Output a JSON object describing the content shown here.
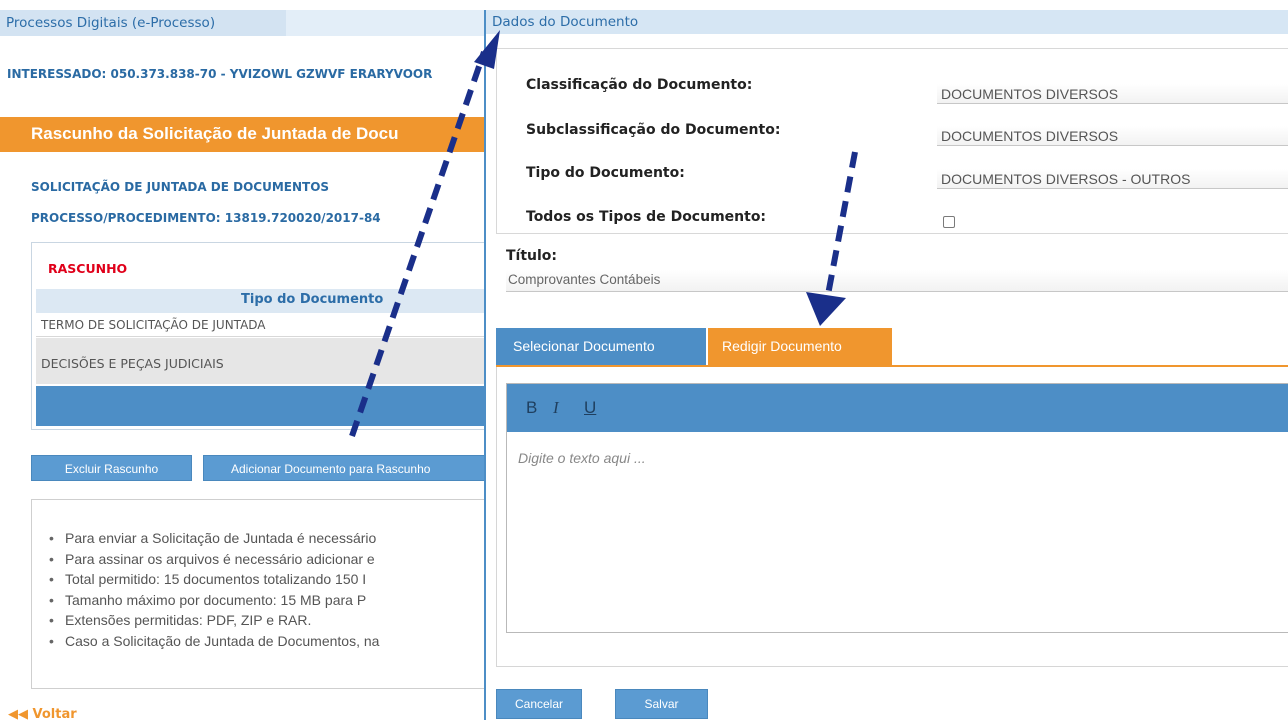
{
  "background": {
    "title": "Processos Digitais (e-Processo)",
    "interessado": "INTERESSADO: 050.373.838-70 - YVIZOWL GZWVF ERARYVOOR",
    "band_title": "Rascunho da Solicitação de Juntada de Docu",
    "solicitacao": "SOLICITAÇÃO DE JUNTADA DE DOCUMENTOS",
    "processo": "PROCESSO/PROCEDIMENTO: 13819.720020/2017-84",
    "rascunho_label": "RASCUNHO",
    "tipo_header": "Tipo do Documento",
    "rows": [
      "TERMO DE SOLICITAÇÃO DE JUNTADA",
      "DECISÕES E PEÇAS JUDICIAIS"
    ],
    "excluir_label": "Excluir Rascunho",
    "adicionar_label": "Adicionar Documento para Rascunho",
    "info_items": [
      "Para enviar a Solicitação de Juntada é necessário",
      "Para assinar os arquivos é necessário adicionar e",
      "Total permitido: 15 documentos totalizando 150 I",
      "Tamanho máximo por documento: 15 MB para P",
      "Extensões permitidas: PDF, ZIP e RAR.",
      "Caso a Solicitação de Juntada de Documentos, na"
    ],
    "voltar": "◀◀ Voltar"
  },
  "modal": {
    "title": "Dados do Documento",
    "fields": [
      {
        "label": "Classificação do Documento:",
        "value": "DOCUMENTOS DIVERSOS"
      },
      {
        "label": "Subclassificação do Documento:",
        "value": "DOCUMENTOS DIVERSOS"
      },
      {
        "label": "Tipo do Documento:",
        "value": "DOCUMENTOS DIVERSOS - OUTROS"
      }
    ],
    "todos_label": "Todos os Tipos de Documento:",
    "titulo_label": "Título:",
    "titulo_value": "Comprovantes Contábeis",
    "tab_selecionar": "Selecionar Documento",
    "tab_redigir": "Redigir Documento",
    "toolbar": {
      "bold": "B",
      "italic": "I",
      "underline": "U"
    },
    "editor_placeholder": "Digite o texto aqui ...",
    "cancelar_label": "Cancelar",
    "salvar_label": "Salvar"
  },
  "colors": {
    "blue": "#4d8ec6",
    "orange": "#f0962e",
    "arrow": "#1a2f8a",
    "red": "#e0001a"
  }
}
